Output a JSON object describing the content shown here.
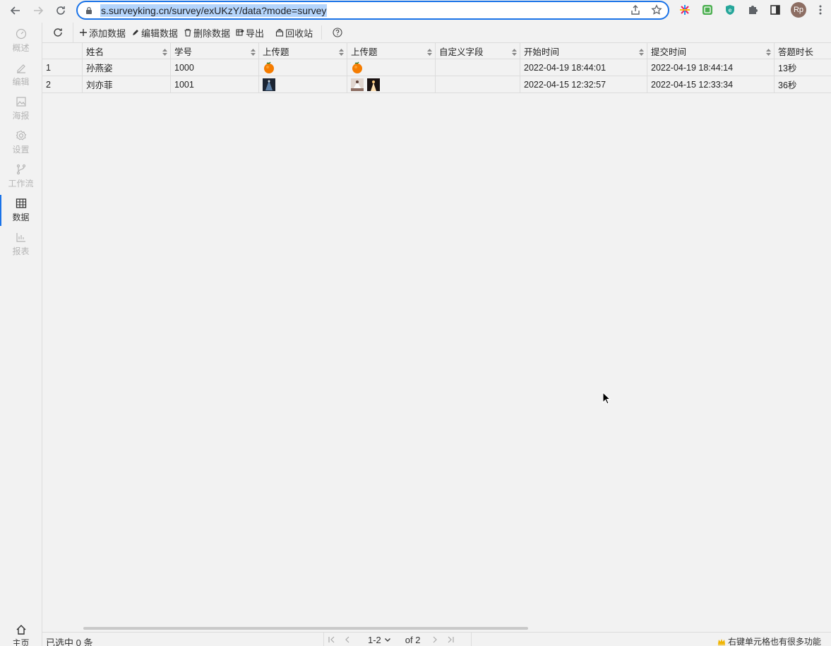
{
  "browser": {
    "url": "s.surveyking.cn/survey/exUKzY/data?mode=survey",
    "avatar_initials": "Rp",
    "colors": {
      "focus": "#1a73e8",
      "selection": "#b4d4fb"
    }
  },
  "sidebar": {
    "items": [
      {
        "label": "概述",
        "icon": "dashboard-icon"
      },
      {
        "label": "编辑",
        "icon": "edit-icon"
      },
      {
        "label": "海报",
        "icon": "image-icon"
      },
      {
        "label": "设置",
        "icon": "gear-icon"
      },
      {
        "label": "工作流",
        "icon": "branch-icon"
      },
      {
        "label": "数据",
        "icon": "table-icon",
        "active": true
      },
      {
        "label": "报表",
        "icon": "bar-chart-icon"
      }
    ],
    "home_label": "主页"
  },
  "toolbar": {
    "add": "添加数据",
    "edit": "编辑数据",
    "delete": "删除数据",
    "export": "导出",
    "recycle": "回收站"
  },
  "table": {
    "headers": [
      "",
      "姓名",
      "学号",
      "上传题",
      "上传题",
      "自定义字段",
      "开始时间",
      "提交时间",
      "答题时长"
    ],
    "rows": [
      {
        "index": "1",
        "name": "孙燕姿",
        "student_id": "1000",
        "upload1": [
          "orange"
        ],
        "upload2": [
          "orange"
        ],
        "custom": "",
        "start": "2022-04-19 18:44:01",
        "submit": "2022-04-19 18:44:14",
        "duration": "13秒"
      },
      {
        "index": "2",
        "name": "刘亦菲",
        "student_id": "1001",
        "upload1": [
          "photo-dark"
        ],
        "upload2": [
          "photo-light",
          "photo-dark"
        ],
        "custom": "",
        "start": "2022-04-15 12:32:57",
        "submit": "2022-04-15 12:33:34",
        "duration": "36秒"
      }
    ]
  },
  "status": {
    "selected": "已选中 0 条",
    "page_range": "1-2",
    "page_of": "of 2",
    "tip": "右键单元格也有很多功能"
  }
}
